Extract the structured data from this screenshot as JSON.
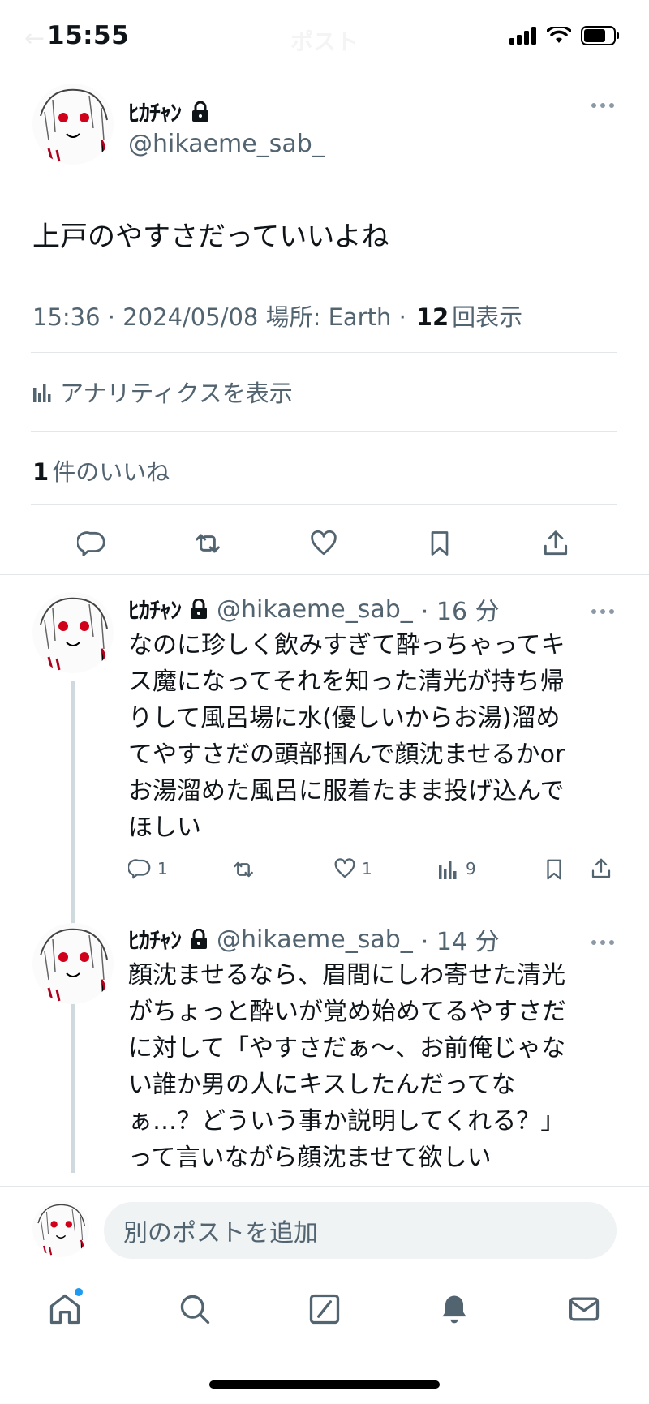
{
  "status_bar": {
    "time": "15:55",
    "center_title": "ポスト"
  },
  "main_post": {
    "author_name": "ﾋｶﾁｬﾝ",
    "handle": "@hikaeme_sab_",
    "text": "上戸のやすさだっていいよね",
    "meta_time_date": "15:36 · 2024/05/08 場所: Earth ·",
    "views_count": "12",
    "views_label": "回表示",
    "analytics_label": "アナリティクスを表示",
    "likes_count": "1",
    "likes_label": "件のいいね"
  },
  "replies": [
    {
      "author_name": "ﾋｶﾁｬﾝ",
      "handle": "@hikaeme_sab_",
      "age": "· 16 分",
      "lines": [
        "なのに珍しく飲みすぎて酔っちゃってキ",
        "ス魔になってそれを知った清光が持ち帰",
        "りして風呂場に水(優しいからお湯)溜め",
        "てやすさだの頭部掴んで顔沈ませるかor",
        "お湯溜めた風呂に服着たまま投げ込んで",
        "ほしい"
      ],
      "reply_count": "1",
      "like_count": "1",
      "view_count": "9"
    },
    {
      "author_name": "ﾋｶﾁｬﾝ",
      "handle": "@hikaeme_sab_",
      "age": "· 14 分",
      "lines": [
        "顔沈ませるなら、眉間にしわ寄せた清光",
        "がちょっと酔いが覚め始めてるやすさだ",
        "に対して「やすさだぁ〜、お前俺じゃな",
        "い誰か男の人にキスしたんだってな",
        "ぁ…？どういう事か説明してくれる？」",
        "って言いながら顔沈ませて欲しい"
      ]
    }
  ],
  "composer": {
    "placeholder": "別のポストを追加"
  },
  "nav": [
    "home-icon",
    "search-icon",
    "grok-icon",
    "notifications-icon",
    "messages-icon"
  ],
  "colors": {
    "accent": "#1d9bf0",
    "muted": "#536471",
    "divider": "#e4e7ea",
    "avatar_eye": "#d0021b"
  }
}
